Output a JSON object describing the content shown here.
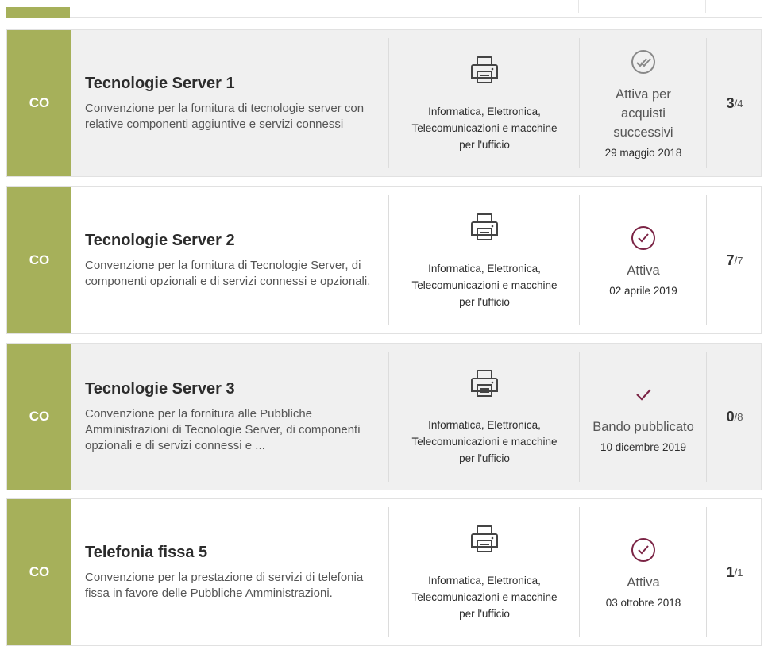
{
  "colors": {
    "badge": "#a6b05a",
    "accent": "#7b2445",
    "muted_check": "#777777"
  },
  "rows": [
    {
      "badge": "CO",
      "title": "Tecnologie Server 1",
      "description": "Convenzione per la fornitura di tecnologie server con relative componenti aggiuntive e servizi connessi",
      "category_icon": "printer-icon",
      "category": "Informatica, Elettronica, Telecomunicazioni e macchine per l'ufficio",
      "status_icon": "double-check-circle-icon",
      "status": "Attiva per acquisti successivi",
      "date": "29 maggio 2018",
      "count": "3",
      "total": "/4"
    },
    {
      "badge": "CO",
      "title": "Tecnologie Server 2",
      "description": "Convenzione per la fornitura di Tecnologie Server, di componenti opzionali e di servizi connessi e opzionali.",
      "category_icon": "printer-icon",
      "category": "Informatica, Elettronica, Telecomunicazioni e macchine per l'ufficio",
      "status_icon": "check-circle-icon",
      "status": "Attiva",
      "date": "02 aprile 2019",
      "count": "7",
      "total": "/7"
    },
    {
      "badge": "CO",
      "title": "Tecnologie Server 3",
      "description": "Convenzione per la fornitura alle Pubbliche Amministrazioni di Tecnologie Server, di componenti opzionali e di servizi connessi e ...",
      "category_icon": "printer-icon",
      "category": "Informatica, Elettronica, Telecomunicazioni e macchine per l'ufficio",
      "status_icon": "check-icon",
      "status": "Bando pubblicato",
      "date": "10 dicembre 2019",
      "count": "0",
      "total": "/8"
    },
    {
      "badge": "CO",
      "title": "Telefonia fissa 5",
      "description": "Convenzione per la prestazione di servizi di telefonia fissa in favore delle Pubbliche Amministrazioni.",
      "category_icon": "printer-icon",
      "category": "Informatica, Elettronica, Telecomunicazioni e macchine per l'ufficio",
      "status_icon": "check-circle-icon",
      "status": "Attiva",
      "date": "03 ottobre 2018",
      "count": "1",
      "total": "/1"
    }
  ]
}
